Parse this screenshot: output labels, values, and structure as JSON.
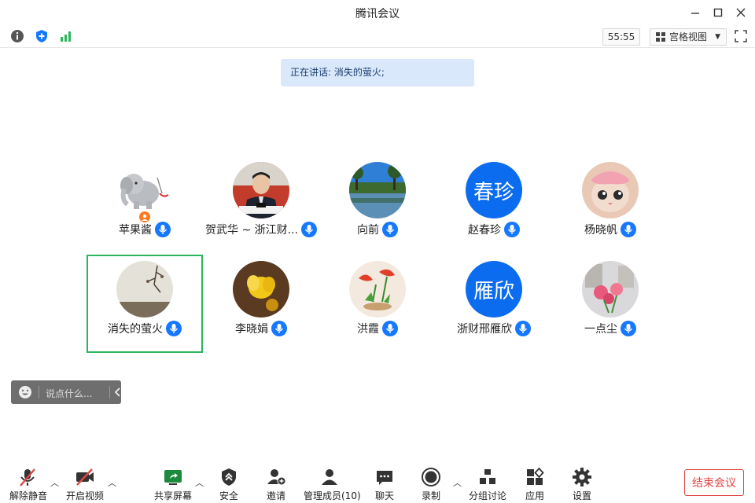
{
  "window": {
    "title": "腾讯会议"
  },
  "toolbar": {
    "timer": "55:55",
    "view_label": "宫格视图"
  },
  "speaking": {
    "text": "正在讲话: 消失的萤火;"
  },
  "participants": [
    {
      "name": "苹果酱"
    },
    {
      "name": "贺武华 ~ 浙江财..."
    },
    {
      "name": "向前"
    },
    {
      "name": "赵春珍",
      "avatar_text": "春珍"
    },
    {
      "name": "杨晓帆"
    },
    {
      "name": "消失的萤火"
    },
    {
      "name": "李晓娟"
    },
    {
      "name": "洪霞"
    },
    {
      "name": "浙财邢雁欣",
      "avatar_text": "雁欣"
    },
    {
      "name": "一点尘"
    }
  ],
  "chat": {
    "placeholder": "说点什么..."
  },
  "bottom": {
    "unmute": "解除静音",
    "video": "开启视频",
    "share": "共享屏幕",
    "security": "安全",
    "invite": "邀请",
    "members": "管理成员(10)",
    "chat": "聊天",
    "record": "录制",
    "breakout": "分组讨论",
    "apps": "应用",
    "settings": "设置",
    "end": "结束会议"
  },
  "colors": {
    "accent": "#1677ff",
    "active_border": "#2db55d",
    "end": "#e34545",
    "speaking_bg": "#d9e8fb"
  }
}
